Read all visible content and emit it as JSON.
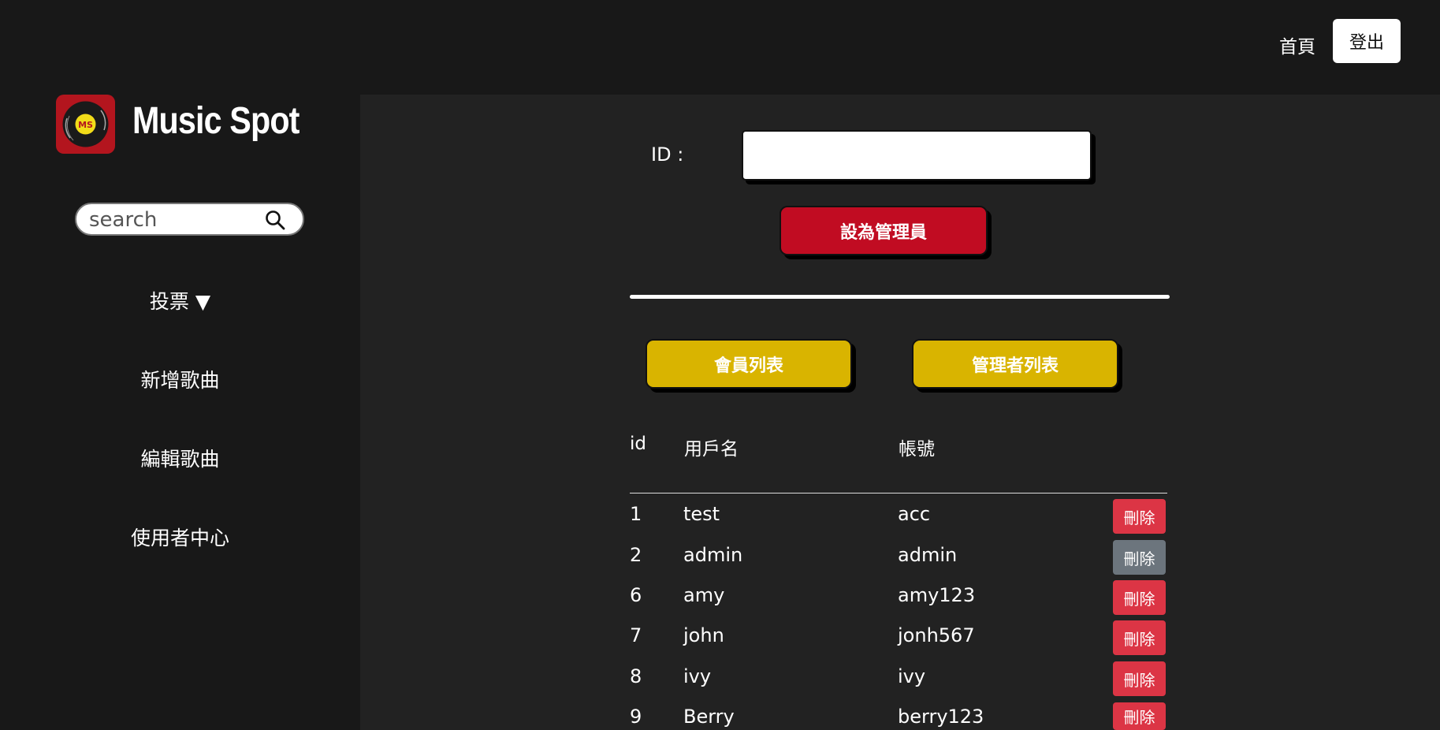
{
  "header": {
    "home_label": "首頁",
    "logout_label": "登出"
  },
  "sidebar": {
    "brand": "Music Spot",
    "logo_text": "MS",
    "search_placeholder": "search",
    "nav": [
      {
        "label": "投票 ▼"
      },
      {
        "label": "新增歌曲"
      },
      {
        "label": "編輯歌曲"
      },
      {
        "label": "使用者中心"
      }
    ]
  },
  "admin_form": {
    "id_label": "ID :",
    "id_value": "",
    "set_admin_label": "設為管理員"
  },
  "list_tabs": {
    "members_label": "會員列表",
    "admins_label": "管理者列表"
  },
  "table": {
    "headers": [
      "id",
      "用戶名",
      "帳號"
    ],
    "rows": [
      {
        "id": "1",
        "username": "test",
        "account": "acc",
        "action": "刪除",
        "action_state": "active"
      },
      {
        "id": "2",
        "username": "admin",
        "account": "admin",
        "action": "刪除",
        "action_state": "disabled"
      },
      {
        "id": "6",
        "username": "amy",
        "account": "amy123",
        "action": "刪除",
        "action_state": "active"
      },
      {
        "id": "7",
        "username": "john",
        "account": "jonh567",
        "action": "刪除",
        "action_state": "active"
      },
      {
        "id": "8",
        "username": "ivy",
        "account": "ivy",
        "action": "刪除",
        "action_state": "active"
      },
      {
        "id": "9",
        "username": "Berry",
        "account": "berry123",
        "action": "刪除",
        "action_state": "active"
      }
    ]
  },
  "colors": {
    "background": "#181818",
    "panel": "#222222",
    "primary_red": "#c10c22",
    "yellow": "#d9b400",
    "delete_red": "#dc3545",
    "delete_disabled": "#6c757d",
    "logo_bg": "#b3151e"
  }
}
